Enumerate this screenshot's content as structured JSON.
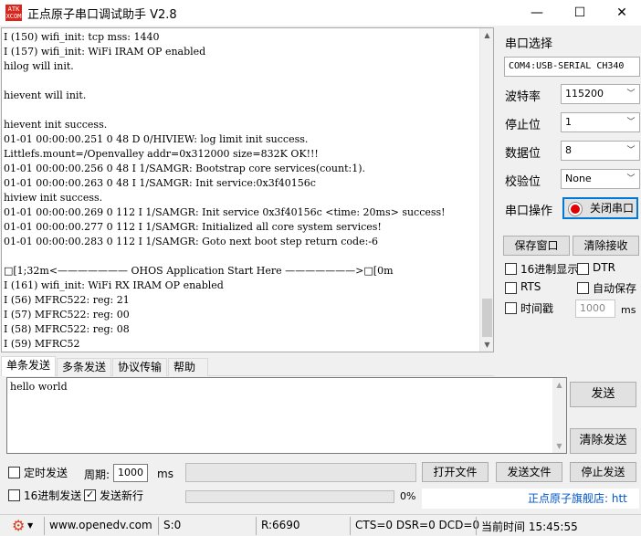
{
  "window": {
    "title": "正点原子串口调试助手 V2.8",
    "icon_text": "ATK XCOM",
    "min_glyph": "—",
    "max_glyph": "☐",
    "close_glyph": "✕"
  },
  "receive": {
    "lines": [
      "I (150) wifi_init: tcp mss: 1440",
      "I (157) wifi_init: WiFi IRAM OP enabled",
      "hilog will init.",
      "",
      "hievent will init.",
      "",
      "hievent init success.",
      "01-01 00:00:00.251 0 48 D 0/HIVIEW: log limit init success.",
      "Littlefs.mount=/Openvalley addr=0x312000 size=832K OK!!!",
      "01-01 00:00:00.256 0 48 I 1/SAMGR: Bootstrap core services(count:1).",
      "01-01 00:00:00.263 0 48 I 1/SAMGR: Init service:0x3f40156c",
      "hiview init success.",
      "01-01 00:00:00.269 0 112 I 1/SAMGR: Init service 0x3f40156c <time: 20ms> success!",
      "01-01 00:00:00.277 0 112 I 1/SAMGR: Initialized all core system services!",
      "01-01 00:00:00.283 0 112 I 1/SAMGR: Goto next boot step return code:-6",
      "",
      "□[1;32m<——————— OHOS Application Start Here ———————>□[0m",
      "I (161) wifi_init: WiFi RX IRAM OP enabled",
      "I (56) MFRC522: reg: 21",
      "I (57) MFRC522: reg: 00",
      "I (58) MFRC522: reg: 08",
      "I (59) MFRC52"
    ]
  },
  "serial": {
    "port_label": "串口选择",
    "port_value": "COM4:USB-SERIAL CH340",
    "baud_label": "波特率",
    "baud_value": "115200",
    "stop_label": "停止位",
    "stop_value": "1",
    "data_label": "数据位",
    "data_value": "8",
    "parity_label": "校验位",
    "parity_value": "None",
    "op_label": "串口操作",
    "op_button": "关闭串口",
    "led_color": "#e00000"
  },
  "receive_options": {
    "save_window": "保存窗口",
    "clear_receive": "清除接收",
    "hex_display": "16进制显示",
    "dtr": "DTR",
    "rts": "RTS",
    "auto_save": "自动保存",
    "timestamp": "时间戳",
    "timestamp_value": "1000",
    "timestamp_unit": "ms"
  },
  "tabs": [
    "单条发送",
    "多条发送",
    "协议传输",
    "帮助"
  ],
  "send": {
    "text": "hello world",
    "send_button": "发送",
    "clear_send_button": "清除发送",
    "timed_send": "定时发送",
    "period_label": "周期:",
    "period_value": "1000",
    "period_unit": "ms",
    "open_file": "打开文件",
    "send_file": "发送文件",
    "stop_send": "停止发送",
    "hex_send": "16进制发送",
    "send_newline": "发送新行",
    "send_newline_checked": true,
    "progress_text": "0%",
    "progress": 0,
    "link_text": "正点原子旗舰店: htt"
  },
  "status": {
    "website": "www.openedv.com",
    "sent": "S:0",
    "received": "R:6690",
    "lines": "CTS=0 DSR=0 DCD=0",
    "time": "当前时间 15:45:55"
  },
  "colors": {
    "accent": "#0078d7",
    "brand_red": "#d8261c",
    "link_blue": "#0055cc"
  }
}
